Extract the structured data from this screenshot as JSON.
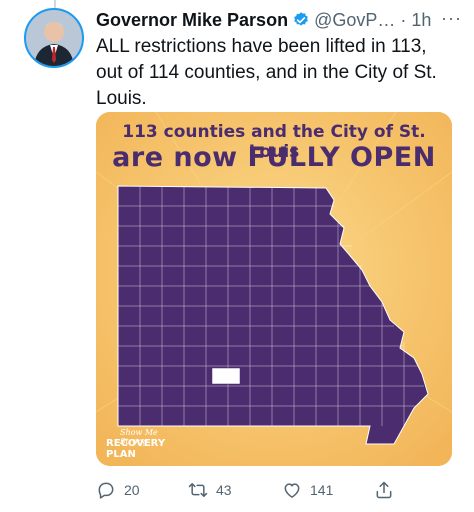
{
  "tweet": {
    "author_name": "Governor Mike Parson",
    "handle_time": "@GovP… · 1h",
    "more_icon": "more-horizontal-icon",
    "text": "ALL restrictions have been lifted in 113, out of 114 counties, and in the City of St. Louis."
  },
  "card": {
    "headline_line1": "113 counties and the City of St. Louis",
    "headline_line2": "are now FULLY OPEN",
    "logo_line1": "Show Me Strong",
    "logo_line2": "RECOVERY PLAN",
    "colors": {
      "background": "#f6c46d",
      "map_fill": "#4a2c6f",
      "closed_county": "#ffffff",
      "headline": "#4a2c6f"
    }
  },
  "actions": {
    "reply_count": "20",
    "retweet_count": "43",
    "like_count": "141",
    "icons": [
      "reply-icon",
      "retweet-icon",
      "like-icon",
      "share-icon"
    ]
  }
}
